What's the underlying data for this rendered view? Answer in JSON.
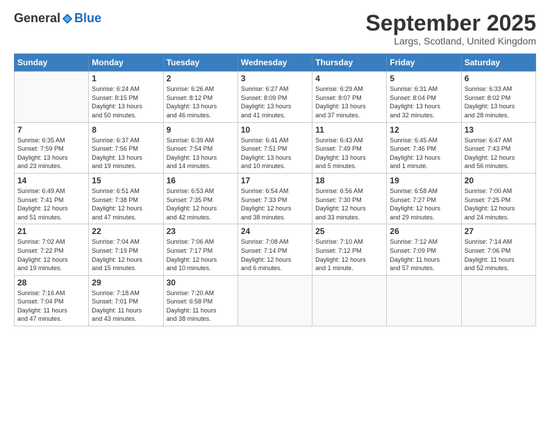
{
  "logo": {
    "general": "General",
    "blue": "Blue"
  },
  "header": {
    "month": "September 2025",
    "location": "Largs, Scotland, United Kingdom"
  },
  "weekdays": [
    "Sunday",
    "Monday",
    "Tuesday",
    "Wednesday",
    "Thursday",
    "Friday",
    "Saturday"
  ],
  "weeks": [
    [
      {
        "day": "",
        "info": ""
      },
      {
        "day": "1",
        "info": "Sunrise: 6:24 AM\nSunset: 8:15 PM\nDaylight: 13 hours\nand 50 minutes."
      },
      {
        "day": "2",
        "info": "Sunrise: 6:26 AM\nSunset: 8:12 PM\nDaylight: 13 hours\nand 46 minutes."
      },
      {
        "day": "3",
        "info": "Sunrise: 6:27 AM\nSunset: 8:09 PM\nDaylight: 13 hours\nand 41 minutes."
      },
      {
        "day": "4",
        "info": "Sunrise: 6:29 AM\nSunset: 8:07 PM\nDaylight: 13 hours\nand 37 minutes."
      },
      {
        "day": "5",
        "info": "Sunrise: 6:31 AM\nSunset: 8:04 PM\nDaylight: 13 hours\nand 32 minutes."
      },
      {
        "day": "6",
        "info": "Sunrise: 6:33 AM\nSunset: 8:02 PM\nDaylight: 13 hours\nand 28 minutes."
      }
    ],
    [
      {
        "day": "7",
        "info": "Sunrise: 6:35 AM\nSunset: 7:59 PM\nDaylight: 13 hours\nand 23 minutes."
      },
      {
        "day": "8",
        "info": "Sunrise: 6:37 AM\nSunset: 7:56 PM\nDaylight: 13 hours\nand 19 minutes."
      },
      {
        "day": "9",
        "info": "Sunrise: 6:39 AM\nSunset: 7:54 PM\nDaylight: 13 hours\nand 14 minutes."
      },
      {
        "day": "10",
        "info": "Sunrise: 6:41 AM\nSunset: 7:51 PM\nDaylight: 13 hours\nand 10 minutes."
      },
      {
        "day": "11",
        "info": "Sunrise: 6:43 AM\nSunset: 7:49 PM\nDaylight: 13 hours\nand 5 minutes."
      },
      {
        "day": "12",
        "info": "Sunrise: 6:45 AM\nSunset: 7:46 PM\nDaylight: 13 hours\nand 1 minute."
      },
      {
        "day": "13",
        "info": "Sunrise: 6:47 AM\nSunset: 7:43 PM\nDaylight: 12 hours\nand 56 minutes."
      }
    ],
    [
      {
        "day": "14",
        "info": "Sunrise: 6:49 AM\nSunset: 7:41 PM\nDaylight: 12 hours\nand 51 minutes."
      },
      {
        "day": "15",
        "info": "Sunrise: 6:51 AM\nSunset: 7:38 PM\nDaylight: 12 hours\nand 47 minutes."
      },
      {
        "day": "16",
        "info": "Sunrise: 6:53 AM\nSunset: 7:35 PM\nDaylight: 12 hours\nand 42 minutes."
      },
      {
        "day": "17",
        "info": "Sunrise: 6:54 AM\nSunset: 7:33 PM\nDaylight: 12 hours\nand 38 minutes."
      },
      {
        "day": "18",
        "info": "Sunrise: 6:56 AM\nSunset: 7:30 PM\nDaylight: 12 hours\nand 33 minutes."
      },
      {
        "day": "19",
        "info": "Sunrise: 6:58 AM\nSunset: 7:27 PM\nDaylight: 12 hours\nand 29 minutes."
      },
      {
        "day": "20",
        "info": "Sunrise: 7:00 AM\nSunset: 7:25 PM\nDaylight: 12 hours\nand 24 minutes."
      }
    ],
    [
      {
        "day": "21",
        "info": "Sunrise: 7:02 AM\nSunset: 7:22 PM\nDaylight: 12 hours\nand 19 minutes."
      },
      {
        "day": "22",
        "info": "Sunrise: 7:04 AM\nSunset: 7:19 PM\nDaylight: 12 hours\nand 15 minutes."
      },
      {
        "day": "23",
        "info": "Sunrise: 7:06 AM\nSunset: 7:17 PM\nDaylight: 12 hours\nand 10 minutes."
      },
      {
        "day": "24",
        "info": "Sunrise: 7:08 AM\nSunset: 7:14 PM\nDaylight: 12 hours\nand 6 minutes."
      },
      {
        "day": "25",
        "info": "Sunrise: 7:10 AM\nSunset: 7:12 PM\nDaylight: 12 hours\nand 1 minute."
      },
      {
        "day": "26",
        "info": "Sunrise: 7:12 AM\nSunset: 7:09 PM\nDaylight: 11 hours\nand 57 minutes."
      },
      {
        "day": "27",
        "info": "Sunrise: 7:14 AM\nSunset: 7:06 PM\nDaylight: 11 hours\nand 52 minutes."
      }
    ],
    [
      {
        "day": "28",
        "info": "Sunrise: 7:16 AM\nSunset: 7:04 PM\nDaylight: 11 hours\nand 47 minutes."
      },
      {
        "day": "29",
        "info": "Sunrise: 7:18 AM\nSunset: 7:01 PM\nDaylight: 11 hours\nand 43 minutes."
      },
      {
        "day": "30",
        "info": "Sunrise: 7:20 AM\nSunset: 6:58 PM\nDaylight: 11 hours\nand 38 minutes."
      },
      {
        "day": "",
        "info": ""
      },
      {
        "day": "",
        "info": ""
      },
      {
        "day": "",
        "info": ""
      },
      {
        "day": "",
        "info": ""
      }
    ]
  ]
}
